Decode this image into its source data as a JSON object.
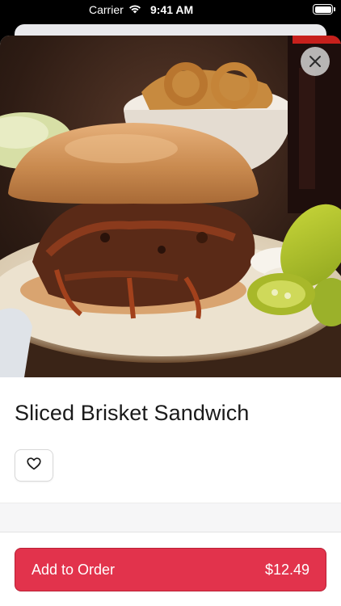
{
  "status_bar": {
    "carrier": "Carrier",
    "time": "9:41 AM"
  },
  "item": {
    "name": "Sliced Brisket Sandwich",
    "price": "$12.49"
  },
  "actions": {
    "add_label": "Add to Order"
  },
  "colors": {
    "accent": "#e2334c",
    "background": "#ffffff"
  },
  "icons": {
    "close": "close-icon",
    "favorite": "heart-icon",
    "wifi": "wifi-icon",
    "battery": "battery-icon"
  }
}
